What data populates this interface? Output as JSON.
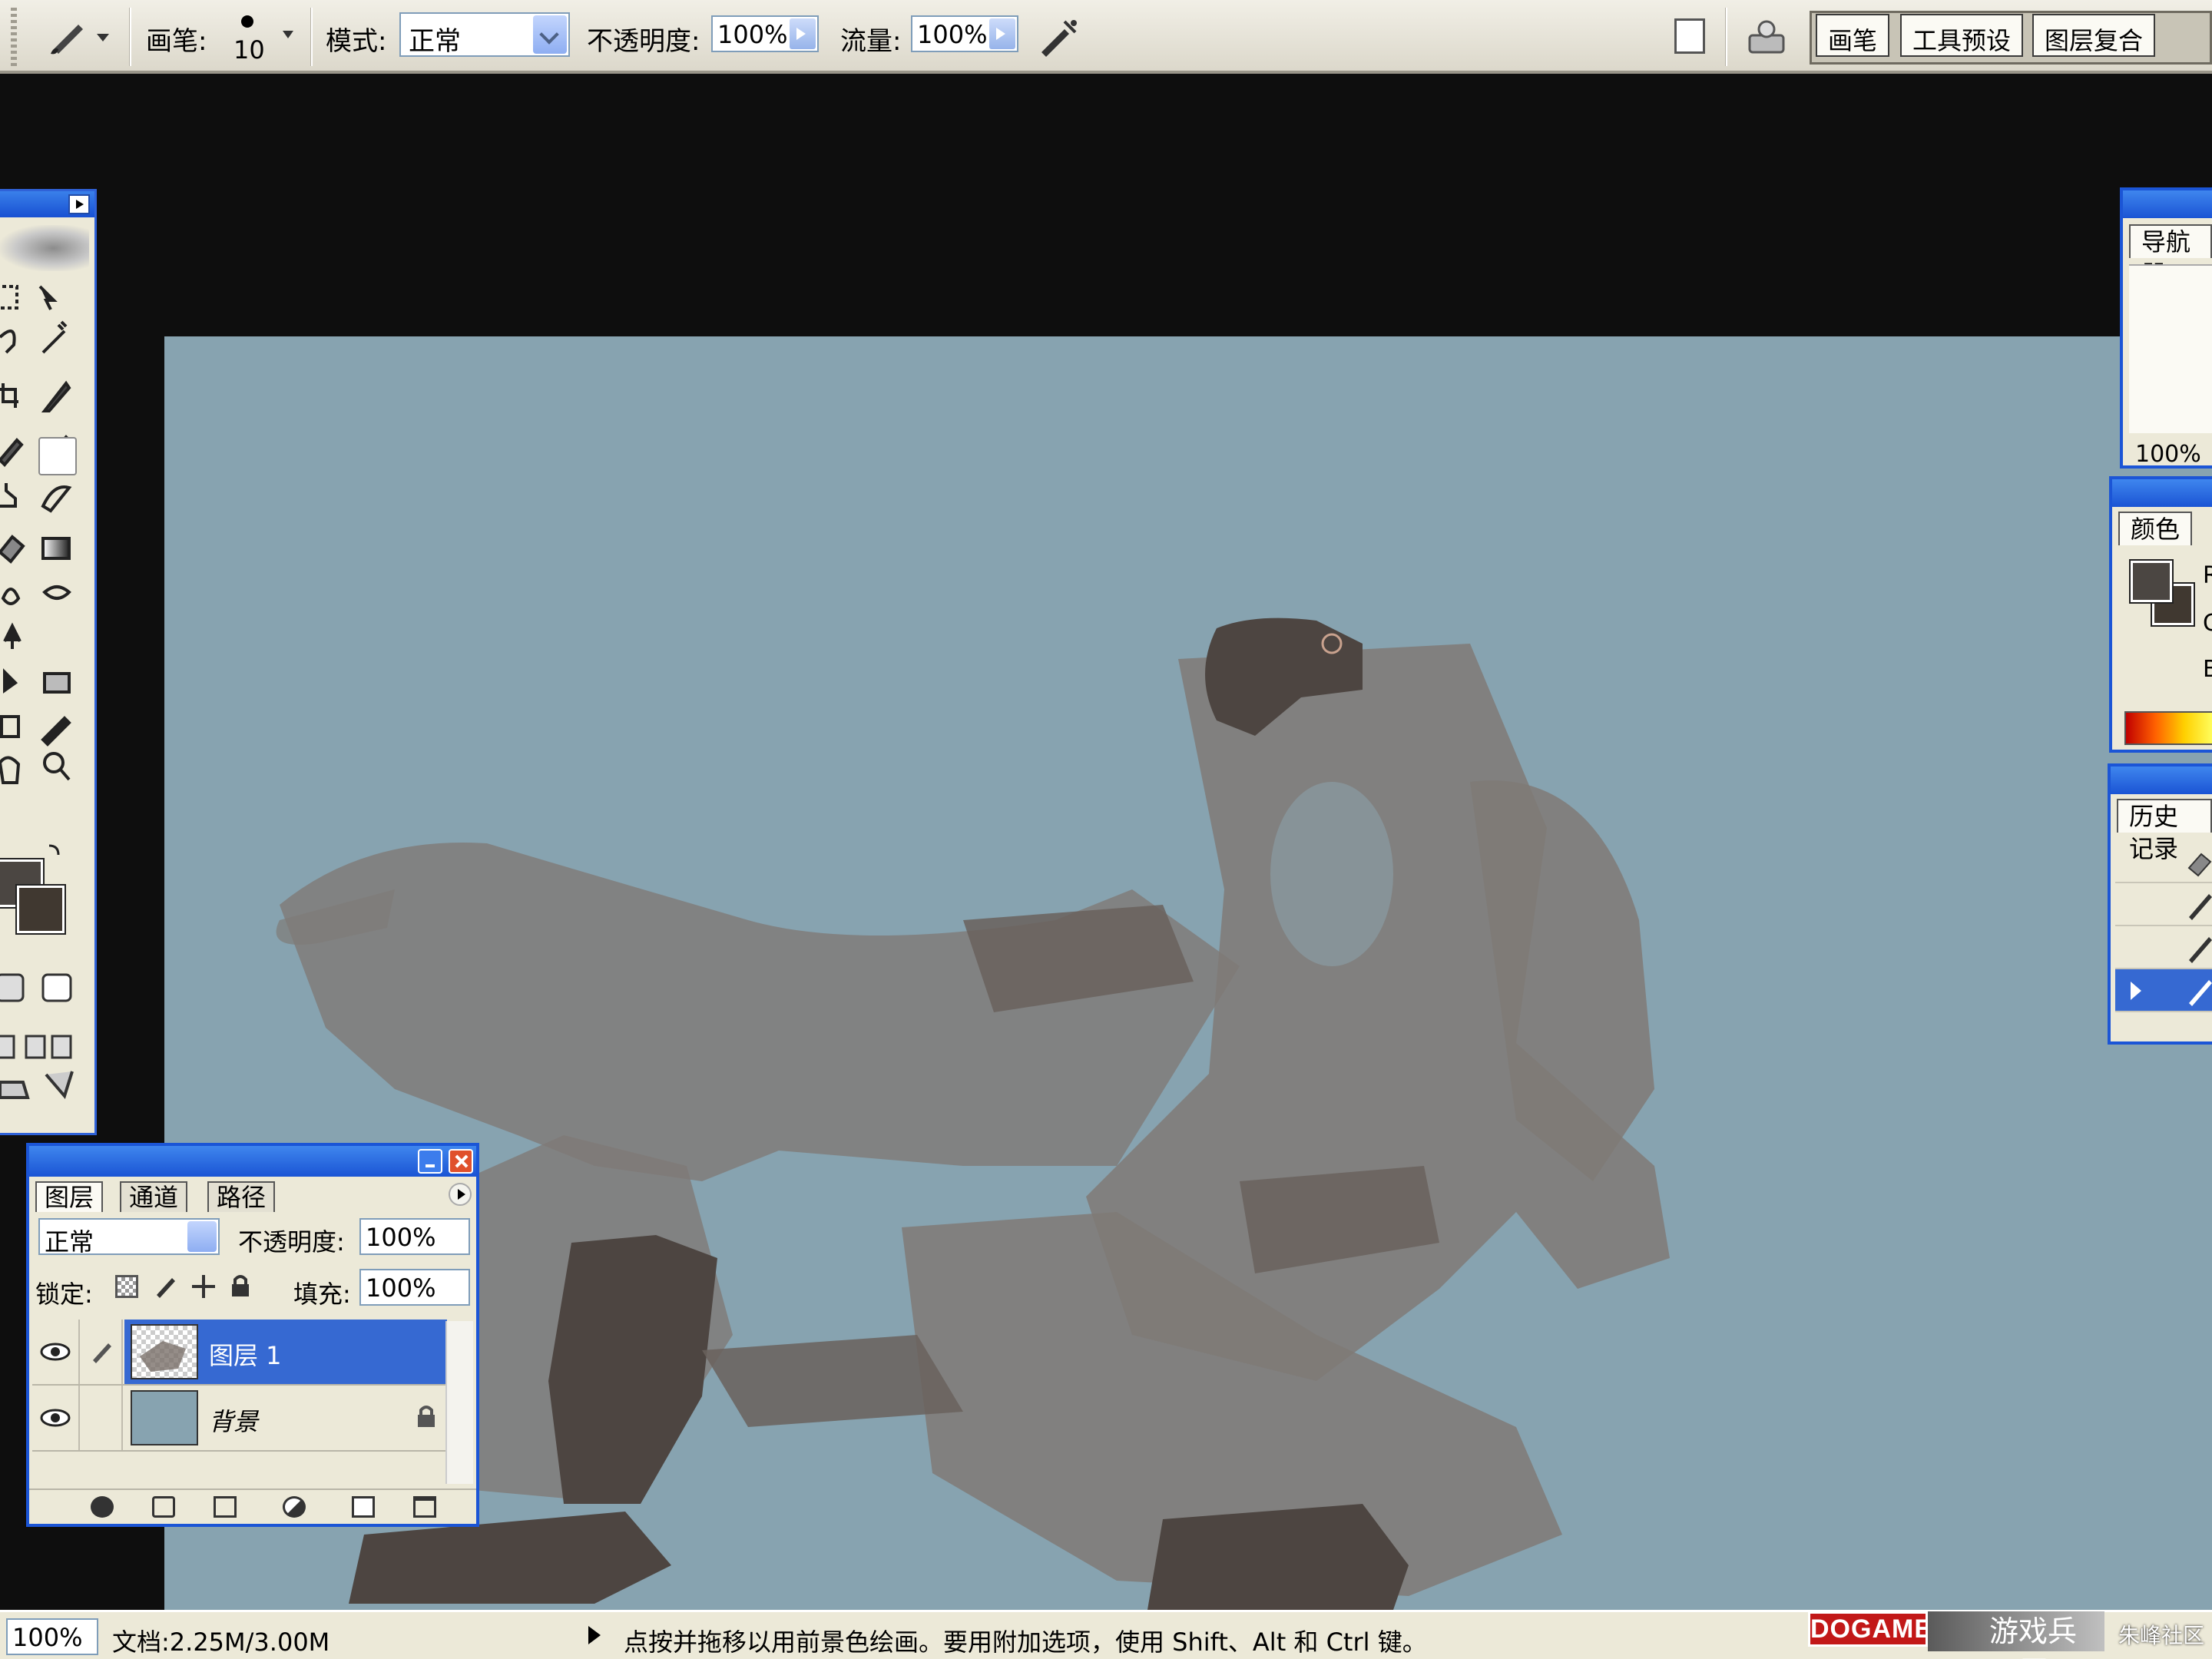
{
  "options_bar": {
    "brush_label": "画笔:",
    "brush_size": "10",
    "mode_label": "模式:",
    "mode_value": "正常",
    "opacity_label": "不透明度:",
    "opacity_value": "100%",
    "flow_label": "流量:",
    "flow_value": "100%"
  },
  "palette_well": {
    "tabs": [
      "画笔",
      "工具预设",
      "图层复合"
    ]
  },
  "layers_panel": {
    "tabs": [
      "图层",
      "通道",
      "路径"
    ],
    "blend_mode": "正常",
    "opacity_label": "不透明度:",
    "opacity_value": "100%",
    "lock_label": "锁定:",
    "fill_label": "填充:",
    "fill_value": "100%",
    "layers": [
      {
        "name": "图层 1",
        "selected": true
      },
      {
        "name": "背景",
        "selected": false
      }
    ]
  },
  "navigator_panel": {
    "tab": "导航器",
    "zoom": "100%"
  },
  "color_panel": {
    "tab": "颜色",
    "channels": [
      "R",
      "G",
      "B"
    ],
    "foreground": "#4b4642",
    "background": "#403830"
  },
  "history_panel": {
    "tab": "历史记录"
  },
  "status_bar": {
    "zoom": "100%",
    "doc_info": "文档:2.25M/3.00M",
    "hint": "点按并拖移以用前景色绘画。要用附加选项，使用 Shift、Alt 和 Ctrl 键。"
  },
  "branding": {
    "logo": "DOGAME",
    "name": "游戏兵工厂",
    "watermark": "朱峰社区"
  },
  "colors": {
    "canvas": "#87a3b0",
    "accent": "#1b55d6",
    "chrome": "#ece9d8"
  }
}
